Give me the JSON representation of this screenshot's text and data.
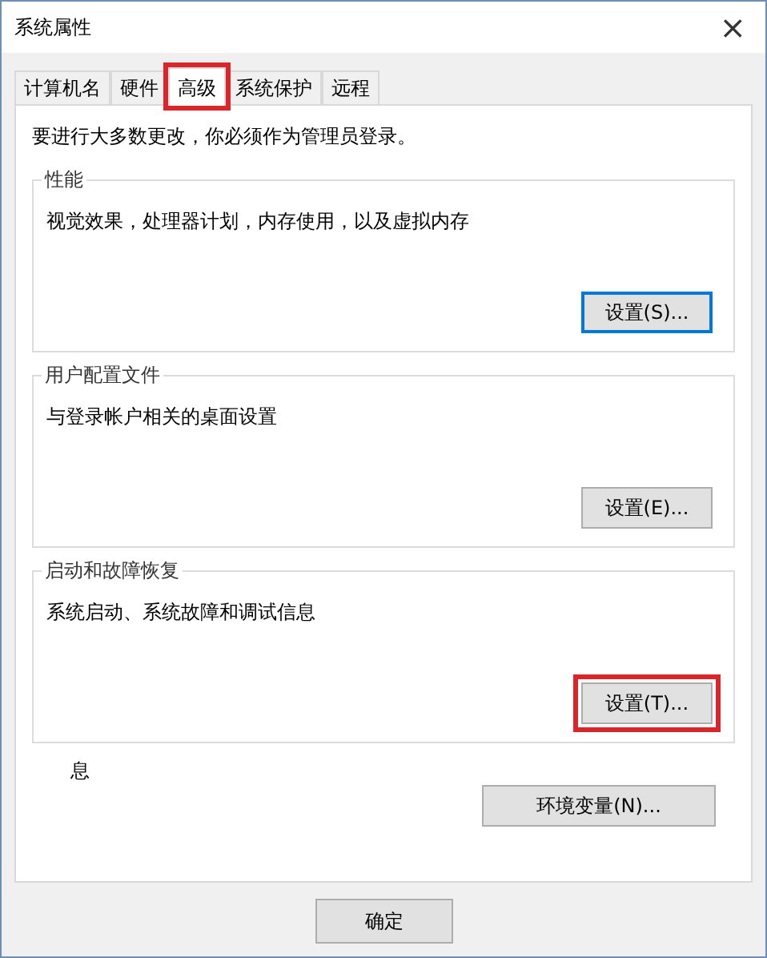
{
  "window": {
    "title": "系统属性",
    "close": "×"
  },
  "tabs": [
    {
      "label": "计算机名",
      "selected": false,
      "highlighted": false
    },
    {
      "label": "硬件",
      "selected": false,
      "highlighted": false
    },
    {
      "label": "高级",
      "selected": true,
      "highlighted": true
    },
    {
      "label": "系统保护",
      "selected": false,
      "highlighted": false
    },
    {
      "label": "远程",
      "selected": false,
      "highlighted": false
    }
  ],
  "notice": "要进行大多数更改，你必须作为管理员登录。",
  "groups": [
    {
      "title": "性能",
      "description": "视觉效果，处理器计划，内存使用，以及虚拟内存",
      "button": {
        "label": "设置(S)...",
        "focused": true,
        "highlighted": false
      }
    },
    {
      "title": "用户配置文件",
      "description": "与登录帐户相关的桌面设置",
      "button": {
        "label": "设置(E)...",
        "focused": false,
        "highlighted": false
      }
    },
    {
      "title": "启动和故障恢复",
      "description": "系统启动、系统故障和调试信息",
      "button": {
        "label": "设置(T)...",
        "focused": false,
        "highlighted": true
      }
    }
  ],
  "partial_label": "息",
  "env_button": "环境变量(N)...",
  "footer_buttons": [
    "确定"
  ]
}
